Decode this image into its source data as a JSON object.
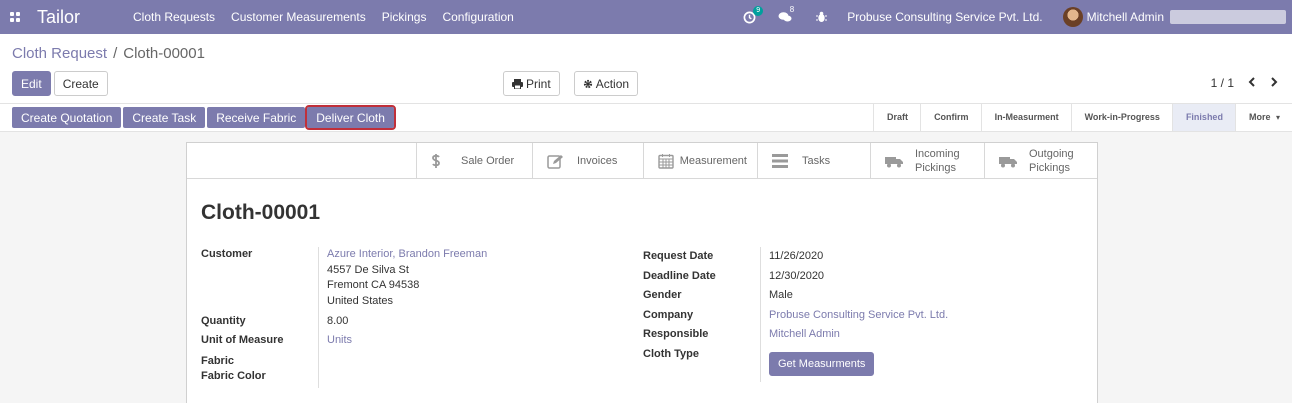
{
  "navbar": {
    "brand": "Tailor",
    "menu": [
      "Cloth Requests",
      "Customer Measurements",
      "Pickings",
      "Configuration"
    ],
    "activity_badge": "9",
    "messages_badge": "8",
    "company": "Probuse Consulting Service Pvt. Ltd.",
    "user": "Mitchell Admin"
  },
  "breadcrumb": {
    "parent": "Cloth Request",
    "separator": "/",
    "current": "Cloth-00001"
  },
  "buttons": {
    "edit": "Edit",
    "create": "Create",
    "print": "Print",
    "action": "Action"
  },
  "pager": {
    "value": "1 / 1",
    "prev": "‹",
    "next": "›"
  },
  "status_buttons": [
    "Create Quotation",
    "Create Task",
    "Receive Fabric",
    "Deliver Cloth"
  ],
  "stages": [
    "Draft",
    "Confirm",
    "In-Measurment",
    "Work-in-Progress",
    "Finished"
  ],
  "stages_more": "More",
  "active_stage": "Finished",
  "smart_buttons": {
    "sale_order": "Sale Order",
    "invoices": "Invoices",
    "measurement": "Measurement",
    "tasks": "Tasks",
    "incoming_1": "Incoming",
    "incoming_2": "Pickings",
    "outgoing_1": "Outgoing",
    "outgoing_2": "Pickings"
  },
  "record": {
    "title": "Cloth-00001",
    "customer_label": "Customer",
    "customer_name": "Azure Interior, Brandon Freeman",
    "address_1": "4557 De Silva St",
    "address_2": "Fremont CA 94538",
    "address_3": "United States",
    "quantity_label": "Quantity",
    "quantity": "8.00",
    "uom_label": "Unit of Measure",
    "uom": "Units",
    "fabric_label": "Fabric",
    "fabric_color_label": "Fabric Color",
    "request_date_label": "Request Date",
    "request_date": "11/26/2020",
    "deadline_date_label": "Deadline Date",
    "deadline_date": "12/30/2020",
    "gender_label": "Gender",
    "gender": "Male",
    "company_label": "Company",
    "company": "Probuse Consulting Service Pvt. Ltd.",
    "responsible_label": "Responsible",
    "responsible": "Mitchell Admin",
    "cloth_type_label": "Cloth Type",
    "get_measurements": "Get Measurments"
  },
  "colors": {
    "brand": "#7c7bad",
    "highlight_outline": "#c0303a"
  }
}
